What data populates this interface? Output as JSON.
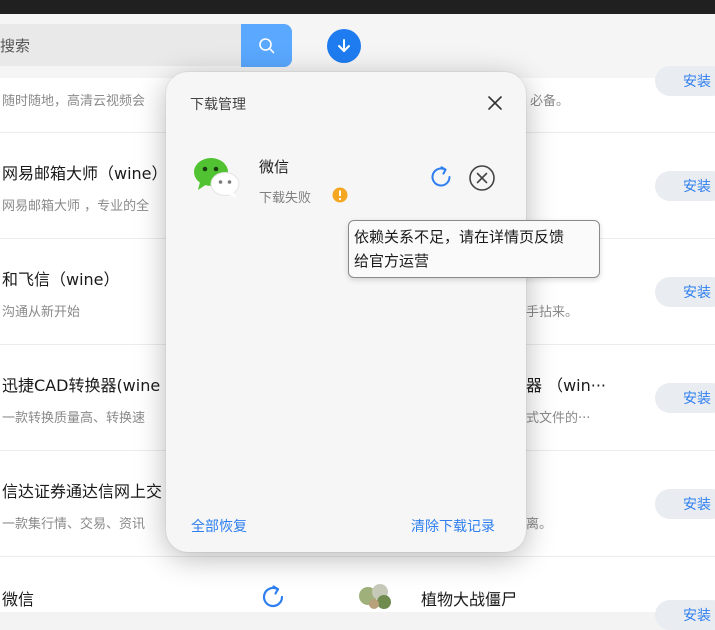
{
  "search": {
    "placeholder": "搜索"
  },
  "apps": [
    {
      "name": "",
      "desc": "随时随地，高清云视频会",
      "right_name": "",
      "right_desc": "必备。",
      "install": "安装"
    },
    {
      "name": "网易邮箱大师（wine）",
      "desc": "网易邮箱大师 ，专业的全",
      "right_name": "",
      "right_desc": "",
      "install": "安装"
    },
    {
      "name": "和飞信（wine）",
      "desc": "沟通从新开始",
      "right_name": "",
      "right_desc": "手拈来。",
      "install": "安装"
    },
    {
      "name": "迅捷CAD转换器(wine",
      "desc": "一款转换质量高、转换速",
      "right_name": "器 （win···",
      "right_desc": "式文件的···",
      "install": "安装"
    },
    {
      "name": "信达证券通达信网上交",
      "desc": "一款集行情、交易、资讯",
      "right_name": "",
      "right_desc": "离。",
      "install": "安装"
    },
    {
      "name": "微信",
      "desc": "",
      "right_name": "植物大战僵尸",
      "right_desc": "",
      "install": "安装"
    }
  ],
  "dialog": {
    "title": "下载管理",
    "item": {
      "name": "微信",
      "status": "下载失败"
    },
    "restore_all": "全部恢复",
    "clear_records": "清除下载记录"
  },
  "tooltip": {
    "line1": "依赖关系不足，请在详情页反馈",
    "line2": "给官方运营"
  },
  "colors": {
    "accent": "#2f7ff0",
    "search_button": "#5aa8ff",
    "download_button": "#1f7cf0",
    "warning": "#f5a623"
  }
}
